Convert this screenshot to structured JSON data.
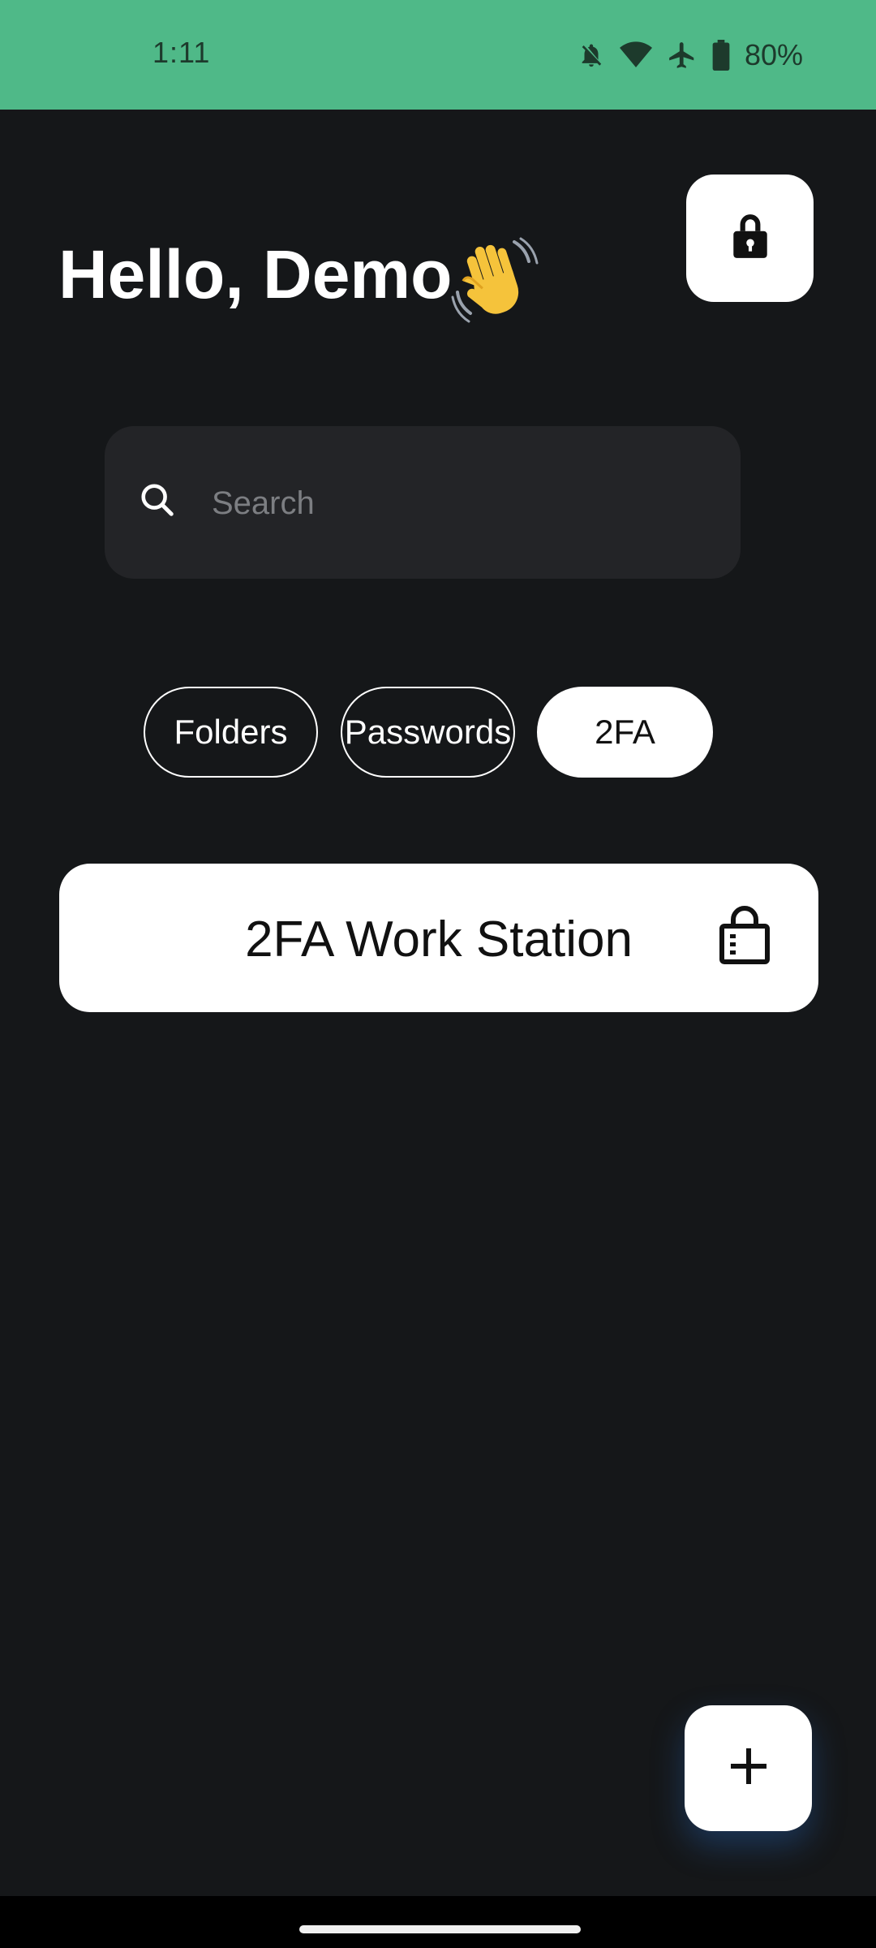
{
  "status_bar": {
    "time": "1:11",
    "battery": "80%",
    "icons": [
      "notifications-off-icon",
      "wifi-icon",
      "airplane-mode-icon",
      "battery-icon"
    ],
    "background_color": "#4FB988"
  },
  "header": {
    "greeting": "Hello, Demo",
    "emoji": "waving-hand",
    "lock_icon": "lock-icon"
  },
  "search": {
    "placeholder": "Search",
    "value": "",
    "icon": "search-icon"
  },
  "filters": {
    "chips": [
      {
        "label": "Folders",
        "active": false
      },
      {
        "label": "Passwords",
        "active": false
      },
      {
        "label": "2FA",
        "active": true
      }
    ]
  },
  "items": [
    {
      "title": "2FA Work Station",
      "icon": "lock-box-icon"
    }
  ],
  "fab": {
    "icon": "plus-icon"
  },
  "theme": {
    "background": "#151719",
    "card": "#ffffff",
    "search_bg": "#232427"
  }
}
